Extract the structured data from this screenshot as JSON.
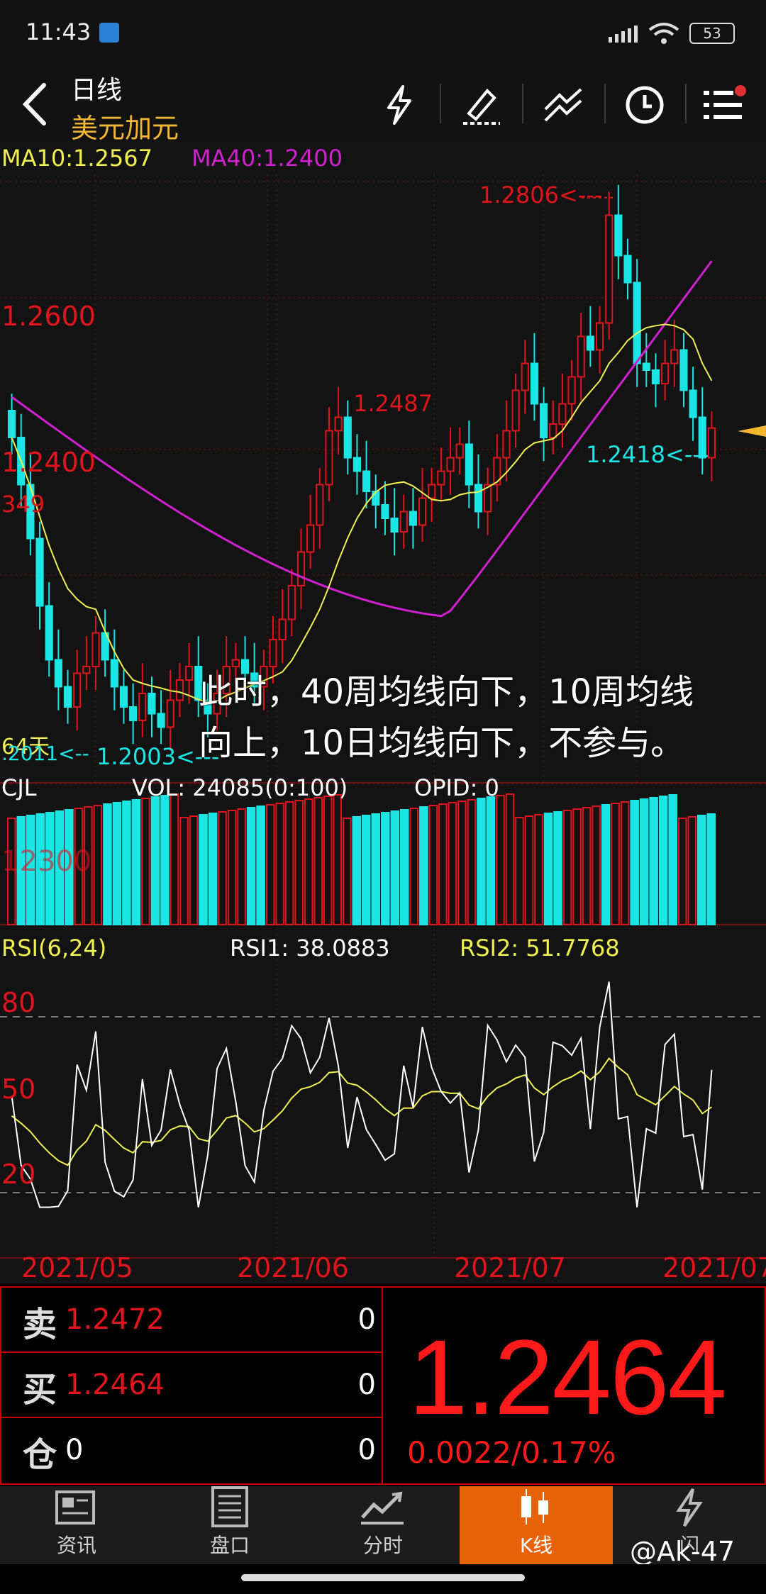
{
  "status": {
    "time": "11:43",
    "battery": "53"
  },
  "header": {
    "title": "日线",
    "subtitle": "美元加元"
  },
  "ma": {
    "ma10": "MA10:1.2567",
    "ma40": "MA40:1.2400"
  },
  "price_chart": {
    "left_labels": {
      "p1": "1.2600",
      "p2": "1.2400",
      "p3": "349",
      "p4": "64天",
      "p5": ".2011<--"
    },
    "annotations": {
      "high": "1.2806<---",
      "peak1": "1.2487",
      "low_recent": "1.2418<---",
      "low": "1.2003<---"
    }
  },
  "overlay_text": {
    "line1": "此时，40周均线向下，10周均线",
    "line2": "向上，10日均线向下，不参与。"
  },
  "volume": {
    "title": "CJL",
    "vol": "VOL: 24085(0:100)",
    "opid": "OPID: 0",
    "ghost": "12300"
  },
  "rsi": {
    "title": "RSI(6,24)",
    "rsi1": "RSI1: 38.0883",
    "rsi2": "RSI2: 51.7768",
    "levels": {
      "l80": "80",
      "l50": "50",
      "l20": "20"
    }
  },
  "dates": [
    "2021/05",
    "2021/06",
    "2021/07",
    "2021/07"
  ],
  "quote": {
    "sell_label": "卖",
    "sell_price": "1.2472",
    "sell_qty": "0",
    "buy_label": "买",
    "buy_price": "1.2464",
    "buy_qty": "0",
    "pos_label": "仓",
    "pos_value": "0",
    "pos_qty": "0",
    "last": "1.2464",
    "change": "0.0022/0.17%"
  },
  "tabs": [
    {
      "label": "资讯",
      "icon": "news-icon"
    },
    {
      "label": "盘口",
      "icon": "orderbook-icon"
    },
    {
      "label": "分时",
      "icon": "timeshare-icon"
    },
    {
      "label": "K线",
      "icon": "candlestick-icon"
    },
    {
      "label": "闪",
      "icon": "flash-icon"
    }
  ],
  "watermark": "@Ak-47",
  "colors": {
    "up": "#e0141c",
    "down": "#1ae6e6",
    "ma10": "#f0f050",
    "ma40": "#d020d0",
    "active_tab": "#e8620a"
  },
  "chart_data": {
    "type": "candlestick",
    "x_range": [
      "2021/04",
      "2021/07"
    ],
    "closes": [
      1.245,
      1.238,
      1.23,
      1.22,
      1.212,
      1.208,
      1.205,
      1.21,
      1.211,
      1.216,
      1.212,
      1.208,
      1.205,
      1.203,
      1.207,
      1.204,
      1.202,
      1.206,
      1.209,
      1.211,
      1.206,
      1.204,
      1.207,
      1.211,
      1.212,
      1.21,
      1.208,
      1.211,
      1.215,
      1.218,
      1.223,
      1.228,
      1.232,
      1.238,
      1.246,
      1.248,
      1.242,
      1.24,
      1.237,
      1.235,
      1.233,
      1.231,
      1.234,
      1.232,
      1.236,
      1.238,
      1.24,
      1.242,
      1.244,
      1.238,
      1.234,
      1.238,
      1.242,
      1.246,
      1.252,
      1.256,
      1.25,
      1.245,
      1.247,
      1.25,
      1.254,
      1.26,
      1.258,
      1.262,
      1.278,
      1.272,
      1.268,
      1.256,
      1.255,
      1.253,
      1.256,
      1.258,
      1.252,
      1.248,
      1.242,
      1.2464
    ]
  }
}
